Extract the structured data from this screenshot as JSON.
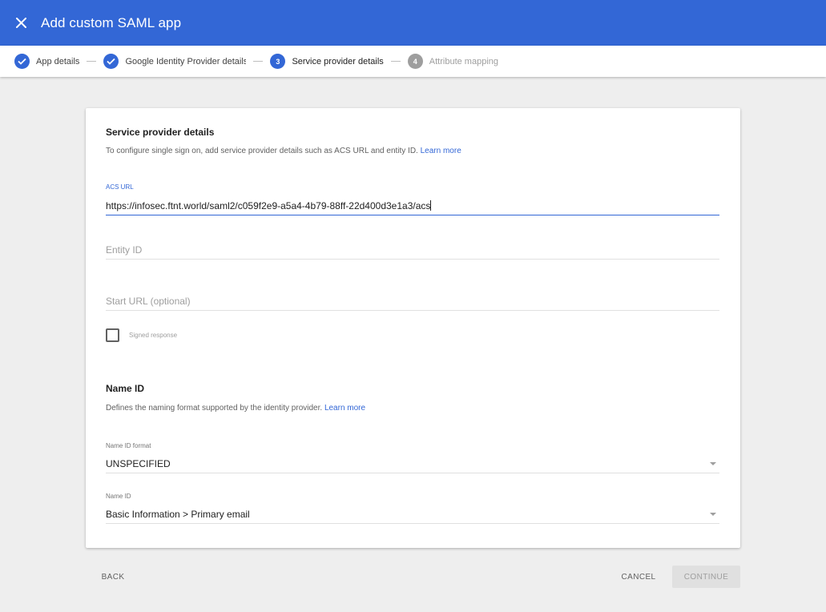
{
  "header": {
    "title": "Add custom SAML app",
    "close_icon": "close-icon",
    "color": "#3367d6"
  },
  "stepper": {
    "steps": [
      {
        "label": "App details",
        "state": "done",
        "marker": ""
      },
      {
        "label": "Google Identity Provider details",
        "state": "done",
        "marker": ""
      },
      {
        "label": "Service provider details",
        "state": "active",
        "marker": "3"
      },
      {
        "label": "Attribute mapping",
        "state": "pending",
        "marker": "4"
      }
    ]
  },
  "service_provider": {
    "title": "Service provider details",
    "description": "To configure single sign on, add service provider details such as ACS URL and entity ID.",
    "learn_more": "Learn more",
    "acs_url": {
      "label": "ACS URL",
      "value": "https://infosec.ftnt.world/saml2/c059f2e9-a5a4-4b79-88ff-22d400d3e1a3/acs"
    },
    "entity_id": {
      "placeholder": "Entity ID",
      "value": ""
    },
    "start_url": {
      "placeholder": "Start URL (optional)",
      "value": ""
    },
    "signed_response": {
      "label": "Signed response",
      "checked": false
    }
  },
  "name_id_section": {
    "title": "Name ID",
    "description": "Defines the naming format supported by the identity provider.",
    "learn_more": "Learn more",
    "name_id_format": {
      "label": "Name ID format",
      "value": "UNSPECIFIED"
    },
    "name_id": {
      "label": "Name ID",
      "value": "Basic Information > Primary email"
    }
  },
  "footer": {
    "back": "BACK",
    "cancel": "CANCEL",
    "continue": "CONTINUE",
    "continue_disabled": true
  }
}
